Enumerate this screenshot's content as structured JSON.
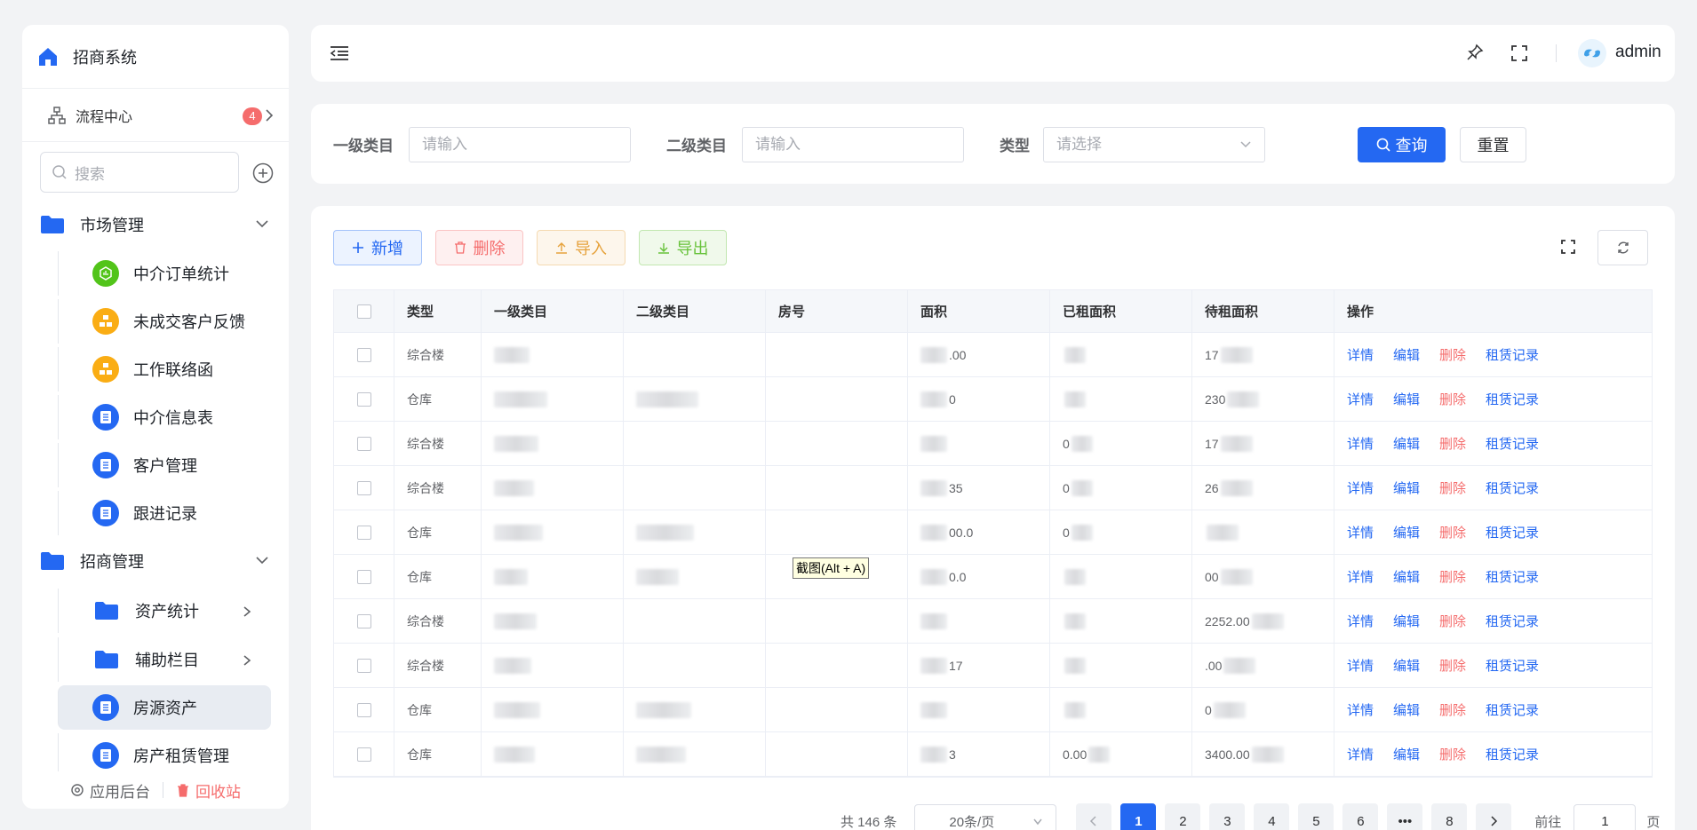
{
  "sidebar": {
    "title": "招商系统",
    "flow_center": {
      "label": "流程中心",
      "badge": "4"
    },
    "search_placeholder": "搜索",
    "groups": [
      {
        "label": "市场管理"
      },
      {
        "label": "招商管理"
      }
    ],
    "market_items": [
      {
        "label": "中介订单统计",
        "color": "#52c41a"
      },
      {
        "label": "未成交客户反馈",
        "color": "#faad14"
      },
      {
        "label": "工作联络函",
        "color": "#faad14"
      },
      {
        "label": "中介信息表",
        "color": "#2468f2"
      },
      {
        "label": "客户管理",
        "color": "#2468f2"
      },
      {
        "label": "跟进记录",
        "color": "#2468f2"
      }
    ],
    "invest_items": [
      {
        "label": "资产统计"
      },
      {
        "label": "辅助栏目"
      },
      {
        "label": "房源资产"
      },
      {
        "label": "房产租赁管理"
      }
    ],
    "footer": {
      "backend": "应用后台",
      "recycle": "回收站"
    }
  },
  "topbar": {
    "user": "admin"
  },
  "filter": {
    "level1_label": "一级类目",
    "level1_placeholder": "请输入",
    "level2_label": "二级类目",
    "level2_placeholder": "请输入",
    "type_label": "类型",
    "type_placeholder": "请选择",
    "query": "查询",
    "reset": "重置"
  },
  "toolbar": {
    "add": "新增",
    "delete": "删除",
    "import": "导入",
    "export": "导出"
  },
  "table": {
    "headers": [
      "类型",
      "一级类目",
      "二级类目",
      "房号",
      "面积",
      "已租面积",
      "待租面积",
      "操作"
    ],
    "actions": [
      "详情",
      "编辑",
      "删除",
      "租赁记录"
    ],
    "rows": [
      {
        "type": "综合楼",
        "area": ".00",
        "pending": "17"
      },
      {
        "type": "仓库",
        "area": "0",
        "pending": "230"
      },
      {
        "type": "综合楼",
        "area": "",
        "pending": "17",
        "rented": "0"
      },
      {
        "type": "综合楼",
        "area": "35",
        "pending": "26",
        "rented": "0"
      },
      {
        "type": "仓库",
        "area": "00.0",
        "pending": "",
        "rented": "0"
      },
      {
        "type": "仓库",
        "area": "0.0",
        "pending": "00",
        "rented": ""
      },
      {
        "type": "综合楼",
        "area": "",
        "pending": "2252.00",
        "rented": ""
      },
      {
        "type": "综合楼",
        "area": "17",
        "pending": ".00",
        "rented": ""
      },
      {
        "type": "仓库",
        "area": "",
        "pending": "0",
        "rented": ""
      },
      {
        "type": "仓库",
        "area": "3",
        "pending": "3400.00",
        "rented": "0.00"
      }
    ]
  },
  "tooltip": "截图(Alt + A)",
  "pagination": {
    "total": "共 146 条",
    "page_size": "20条/页",
    "pages": [
      "1",
      "2",
      "3",
      "4",
      "5",
      "6",
      "•••",
      "8"
    ],
    "goto": "前往",
    "jump_value": "1",
    "page_suffix": "页"
  }
}
